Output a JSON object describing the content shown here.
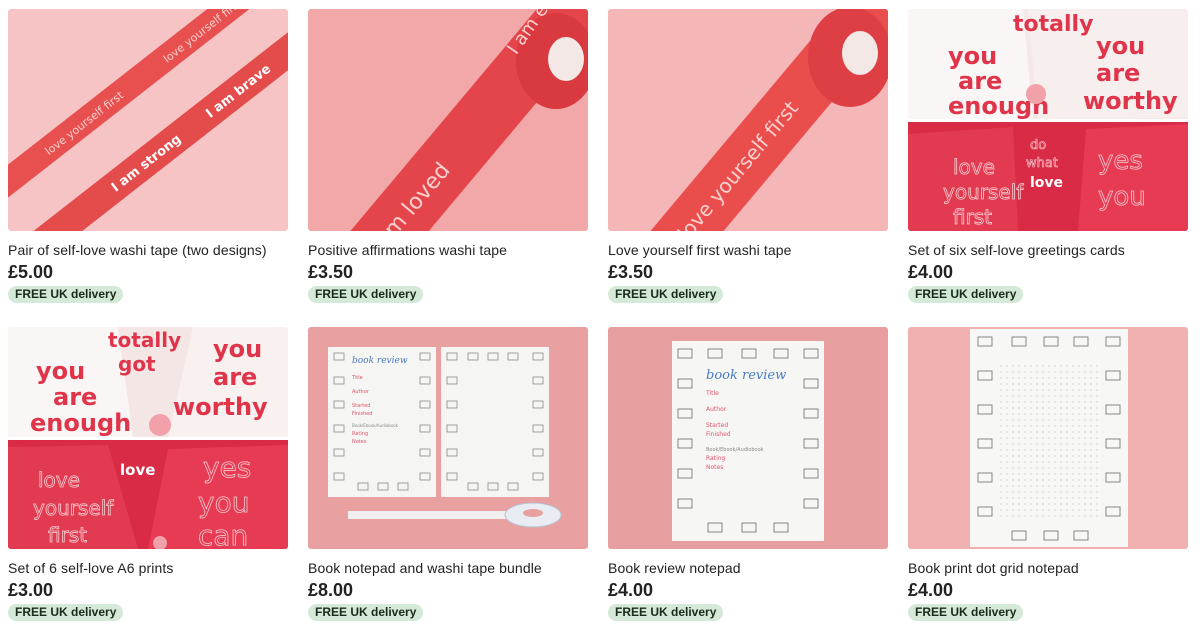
{
  "listings": [
    {
      "title": "Pair of self-love washi tape (two designs)",
      "price": "£5.00",
      "badge": "FREE UK delivery"
    },
    {
      "title": "Positive affirmations washi tape",
      "price": "£3.50",
      "badge": "FREE UK delivery"
    },
    {
      "title": "Love yourself first washi tape",
      "price": "£3.50",
      "badge": "FREE UK delivery"
    },
    {
      "title": "Set of six self-love greetings cards",
      "price": "£4.00",
      "badge": "FREE UK delivery"
    },
    {
      "title": "Set of 6 self-love A6 prints",
      "price": "£3.00",
      "badge": "FREE UK delivery"
    },
    {
      "title": "Book notepad and washi tape bundle",
      "price": "£8.00",
      "badge": "FREE UK delivery"
    },
    {
      "title": "Book review notepad",
      "price": "£4.00",
      "badge": "FREE UK delivery"
    },
    {
      "title": "Book print dot grid notepad",
      "price": "£4.00",
      "badge": "FREE UK delivery"
    }
  ],
  "artwork": {
    "tape1_a": "love yourself first",
    "tape1_b": "love yourself first",
    "tape2_a": "I am strong",
    "tape2_b": "I am brave",
    "tape3": "I am loved",
    "tape3_roll": "I am eno",
    "tape4": "love yourself first",
    "card_you": "you",
    "card_are": "are",
    "card_enough": "enough",
    "card_worthy": "worthy",
    "card_totally": "totally",
    "card_got": "got",
    "card_love": "love",
    "card_yourself": "yourself",
    "card_first": "first",
    "card_do": "do",
    "card_what": "what",
    "card_yes": "yes",
    "card_you2": "you",
    "card_can": "can",
    "book_review": "book review",
    "field_title": "Title",
    "field_author": "Author",
    "field_started": "Started",
    "field_finished": "Finished",
    "field_format": "Book/Ebook/Audiobook",
    "field_rating": "Rating",
    "field_notes": "Notes"
  },
  "colors": {
    "price_text": "#222222",
    "badge_bg": "#d4e9d7",
    "pink_bg": "#f4b3b8",
    "tape_red": "#e8504f",
    "card_red": "#e0344a"
  }
}
